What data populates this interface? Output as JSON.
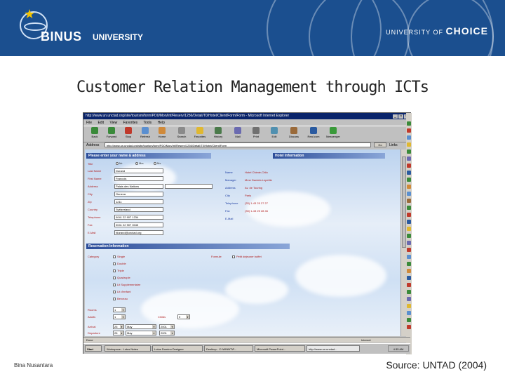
{
  "banner": {
    "university_name": "BINUS",
    "university_word": "UNIVERSITY",
    "tagline_prefix": "UNIVERSITY OF",
    "tagline_word": "CHOICE"
  },
  "slide": {
    "title": "Customer Relation Management through ICTs",
    "footer_left": "Bina Nusantara",
    "footer_right": "Source: UNTAD (2004)"
  },
  "browser": {
    "window_title": "http://www.un.unctad.org/site/tourism/form/PD0/Mon/Inf/Reserv/1256/Detail/T0/Hotel/Client/Form/Form - Microsoft Internet Explorer",
    "menu": [
      "File",
      "Edit",
      "View",
      "Favorites",
      "Tools",
      "Help"
    ],
    "toolbar": [
      "Back",
      "Forward",
      "Stop",
      "Refresh",
      "Home",
      "Search",
      "Favorites",
      "History",
      "Mail",
      "Print",
      "Edit",
      "Discuss",
      "Real.com",
      "Messenger"
    ],
    "address_label": "Address",
    "address_url": "http://www.un.unctad.org/site/tourism/form/PD0/Mon/Inf/Reserv/1256/Detail/T0/Hotel/Client/Form",
    "go_label": "Go",
    "links_label": "Links",
    "status_left": "Done",
    "status_right": "Internet",
    "taskbar": {
      "start": "Start",
      "tasks": [
        "Workspace - Lotus Notes",
        "Lotus Domino Designer",
        "Desktop - C:\\WINNT\\P...",
        "Microsoft PowerPoint...",
        "http://www.un.unctad..."
      ],
      "clock": "4:35 AM"
    }
  },
  "form": {
    "guest_header": "Please enter your name & address",
    "hotel_header": "Hotel Information",
    "reservation_header": "Reservation Information",
    "fields": [
      {
        "label": "Title",
        "value": ""
      },
      {
        "label": "Last Name",
        "value": "Durand"
      },
      {
        "label": "First Name",
        "value": "Francois"
      },
      {
        "label": "Address",
        "value": "Palais des Nations"
      },
      {
        "label": "City",
        "value": "Geneva"
      },
      {
        "label": "Zip",
        "value": "1211"
      },
      {
        "label": "Country",
        "value": "Switzerland"
      },
      {
        "label": "Telephone",
        "value": "0041 22 907 1234"
      },
      {
        "label": "Fax",
        "value": "0041 22 907 0043"
      },
      {
        "label": "E-Mail",
        "value": "fdurand@unctad.org"
      }
    ],
    "title_options": [
      "Mr",
      "Mrs",
      "Ms"
    ],
    "hotel": [
      {
        "label": "Name",
        "value": "Hotel Chimie-Chlic"
      },
      {
        "label": "Manager",
        "value": "Mme Daniela Lepetite"
      },
      {
        "label": "Address",
        "value": "Av. de Touring"
      },
      {
        "label": "City",
        "value": "Paris"
      },
      {
        "label": "Telephone",
        "value": "(33) 1-43 25 27 27"
      },
      {
        "label": "Fax",
        "value": "(33) 1-43 25 28 46"
      },
      {
        "label": "E-Mail",
        "value": ""
      }
    ],
    "category_label": "Category",
    "categories": [
      "Single",
      "Double",
      "Triple",
      "Quadruple",
      "Lit Supplementaire",
      "Lit d'enfant",
      "Berceau"
    ],
    "breakfast_label": "Formule",
    "breakfast_option": "Petit dejeuner buffet",
    "rooms_label": "Rooms",
    "rooms_value": "1",
    "adults_label": "Adults",
    "adults_value": "1",
    "children_label": "Childs",
    "children_value": "0",
    "arrival_label": "Arrival",
    "arrival": {
      "day": "25",
      "month": "May",
      "year": "2001"
    },
    "departure_label": "Departure",
    "departure": {
      "day": "26",
      "month": "May",
      "year": "2001"
    }
  }
}
